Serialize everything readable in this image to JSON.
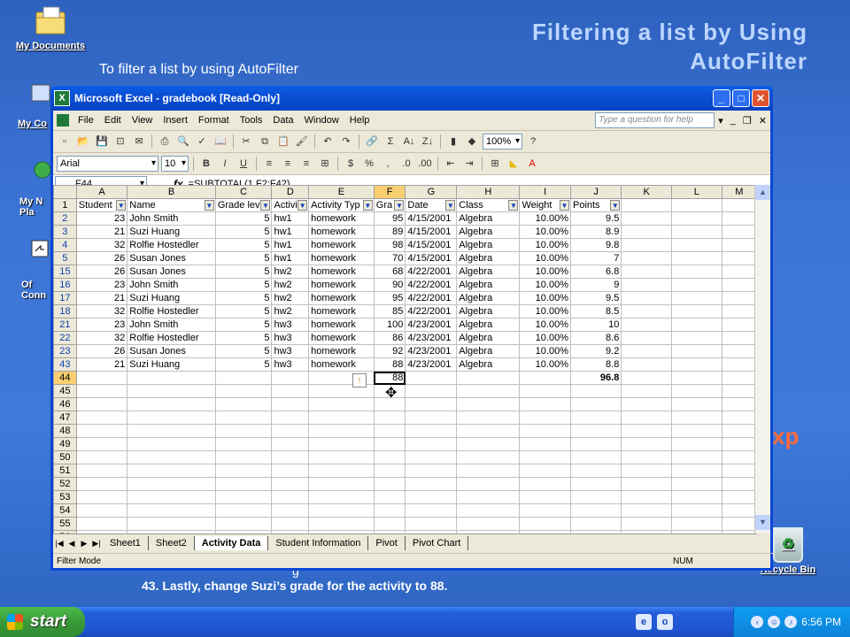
{
  "slide": {
    "title_line1": "Filtering a list by Using",
    "title_line2": "AutoFilter",
    "subtitle": "To filter a list by using AutoFilter",
    "foot_line1": "g",
    "foot_line2": "43. Lastly, change Suzi’s grade for the activity to 88.",
    "orange_text": "xp"
  },
  "desktop_icons": [
    {
      "label": "My Documents",
      "icon": "folder-documents-icon"
    },
    {
      "label": "My Co",
      "icon": "computer-icon"
    },
    {
      "label": "My N Pla",
      "icon": "network-places-icon"
    },
    {
      "label": "Of Conn",
      "icon": "office-connect-icon"
    },
    {
      "label": "Recycle Bin",
      "icon": "recycle-bin-icon"
    }
  ],
  "window": {
    "title": "Microsoft Excel - gradebook  [Read-Only]",
    "menu": [
      "File",
      "Edit",
      "View",
      "Insert",
      "Format",
      "Tools",
      "Data",
      "Window",
      "Help"
    ],
    "ask_placeholder": "Type a question for help",
    "zoom": "100%",
    "font": "Arial",
    "font_size": "10",
    "name_box": "F44",
    "formula": "=SUBTOTAL(1,F2:F42)"
  },
  "sheet": {
    "columns": [
      "A",
      "B",
      "C",
      "D",
      "E",
      "F",
      "G",
      "H",
      "I",
      "J",
      "K",
      "L",
      "M"
    ],
    "headers": [
      "Student",
      "Name",
      "Grade lev",
      "Activi",
      "Activity Typ",
      "Gra",
      "Date",
      "Class",
      "Weight",
      "Points",
      "",
      "",
      ""
    ],
    "header_row_number": "1",
    "rows": [
      {
        "n": "2",
        "cells": [
          "23",
          "John Smith",
          "5",
          "hw1",
          "homework",
          "95",
          "4/15/2001",
          "Algebra",
          "10.00%",
          "9.5"
        ]
      },
      {
        "n": "3",
        "cells": [
          "21",
          "Suzi Huang",
          "5",
          "hw1",
          "homework",
          "89",
          "4/15/2001",
          "Algebra",
          "10.00%",
          "8.9"
        ]
      },
      {
        "n": "4",
        "cells": [
          "32",
          "Rolfie Hostedler",
          "5",
          "hw1",
          "homework",
          "98",
          "4/15/2001",
          "Algebra",
          "10.00%",
          "9.8"
        ]
      },
      {
        "n": "5",
        "cells": [
          "26",
          "Susan Jones",
          "5",
          "hw1",
          "homework",
          "70",
          "4/15/2001",
          "Algebra",
          "10.00%",
          "7"
        ]
      },
      {
        "n": "15",
        "cells": [
          "26",
          "Susan Jones",
          "5",
          "hw2",
          "homework",
          "68",
          "4/22/2001",
          "Algebra",
          "10.00%",
          "6.8"
        ]
      },
      {
        "n": "16",
        "cells": [
          "23",
          "John Smith",
          "5",
          "hw2",
          "homework",
          "90",
          "4/22/2001",
          "Algebra",
          "10.00%",
          "9"
        ]
      },
      {
        "n": "17",
        "cells": [
          "21",
          "Suzi Huang",
          "5",
          "hw2",
          "homework",
          "95",
          "4/22/2001",
          "Algebra",
          "10.00%",
          "9.5"
        ]
      },
      {
        "n": "18",
        "cells": [
          "32",
          "Rolfie Hostedler",
          "5",
          "hw2",
          "homework",
          "85",
          "4/22/2001",
          "Algebra",
          "10.00%",
          "8.5"
        ]
      },
      {
        "n": "21",
        "cells": [
          "23",
          "John Smith",
          "5",
          "hw3",
          "homework",
          "100",
          "4/23/2001",
          "Algebra",
          "10.00%",
          "10"
        ]
      },
      {
        "n": "22",
        "cells": [
          "32",
          "Rolfie Hostedler",
          "5",
          "hw3",
          "homework",
          "86",
          "4/23/2001",
          "Algebra",
          "10.00%",
          "8.6"
        ]
      },
      {
        "n": "23",
        "cells": [
          "26",
          "Susan Jones",
          "5",
          "hw3",
          "homework",
          "92",
          "4/23/2001",
          "Algebra",
          "10.00%",
          "9.2"
        ]
      },
      {
        "n": "43",
        "cells": [
          "21",
          "Suzi Huang",
          "5",
          "hw3",
          "homework",
          "88",
          "4/23/2001",
          "Algebra",
          "10.00%",
          "8.8"
        ]
      },
      {
        "n": "44",
        "cells": [
          "",
          "",
          "",
          "",
          "",
          "88",
          "",
          "",
          "",
          "96.8"
        ]
      }
    ],
    "empty_rows": [
      "45",
      "46",
      "47",
      "48",
      "49",
      "50",
      "51",
      "52",
      "53",
      "54",
      "55",
      "56"
    ],
    "tabs": [
      "Sheet1",
      "Sheet2",
      "Activity Data",
      "Student Information",
      "Pivot",
      "Pivot Chart"
    ],
    "active_tab": "Activity Data"
  },
  "status": {
    "mode": "Filter Mode",
    "num": "NUM"
  },
  "taskbar": {
    "start": "start",
    "clock": "6:56 PM"
  },
  "colors": {
    "title_blue": "#bcd6ff",
    "filtered_row_header": "#0a3fb0",
    "selection_header": "#f9cf72",
    "xp_blue": "#0a46d6"
  }
}
